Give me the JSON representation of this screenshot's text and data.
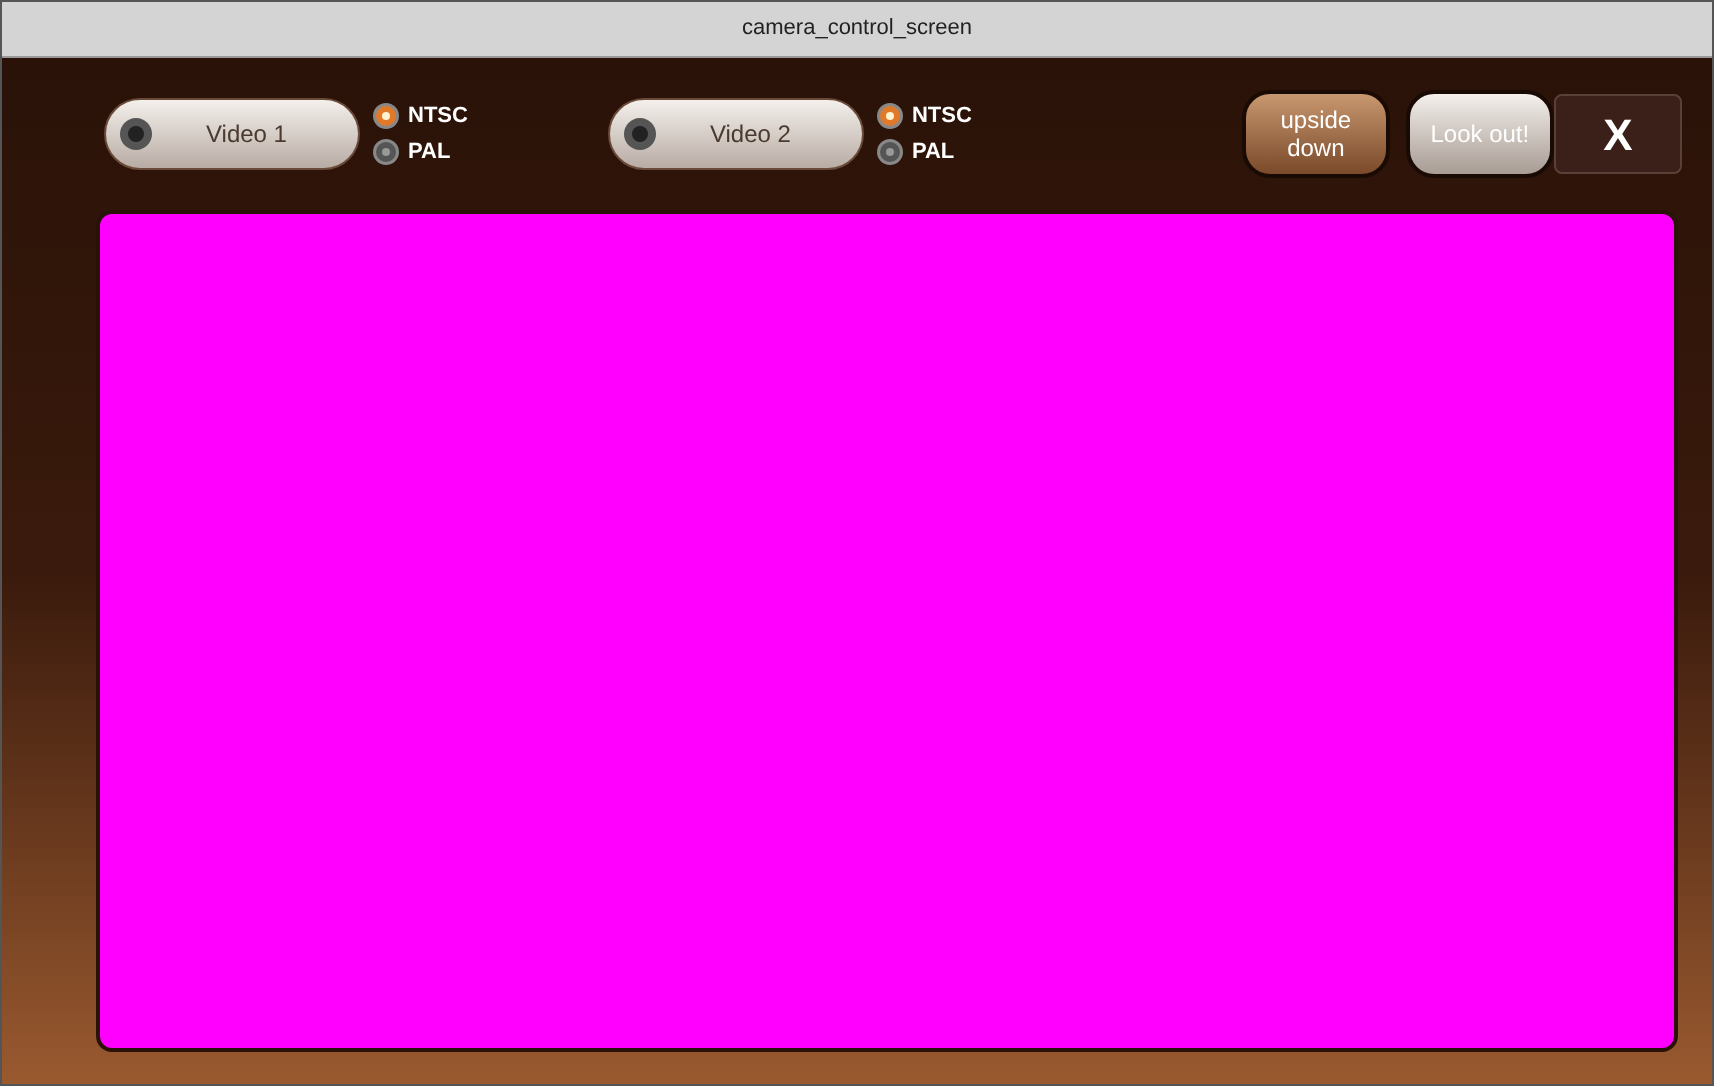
{
  "window": {
    "title": "camera_control_screen"
  },
  "video_sources": [
    {
      "label": "Video 1",
      "formats": [
        {
          "label": "NTSC",
          "selected": true
        },
        {
          "label": "PAL",
          "selected": false
        }
      ]
    },
    {
      "label": "Video 2",
      "formats": [
        {
          "label": "NTSC",
          "selected": true
        },
        {
          "label": "PAL",
          "selected": false
        }
      ]
    }
  ],
  "toggles": [
    {
      "label": "upside down",
      "selected": true
    },
    {
      "label": "Look out!",
      "selected": false
    }
  ],
  "close_button": {
    "label": "X"
  }
}
